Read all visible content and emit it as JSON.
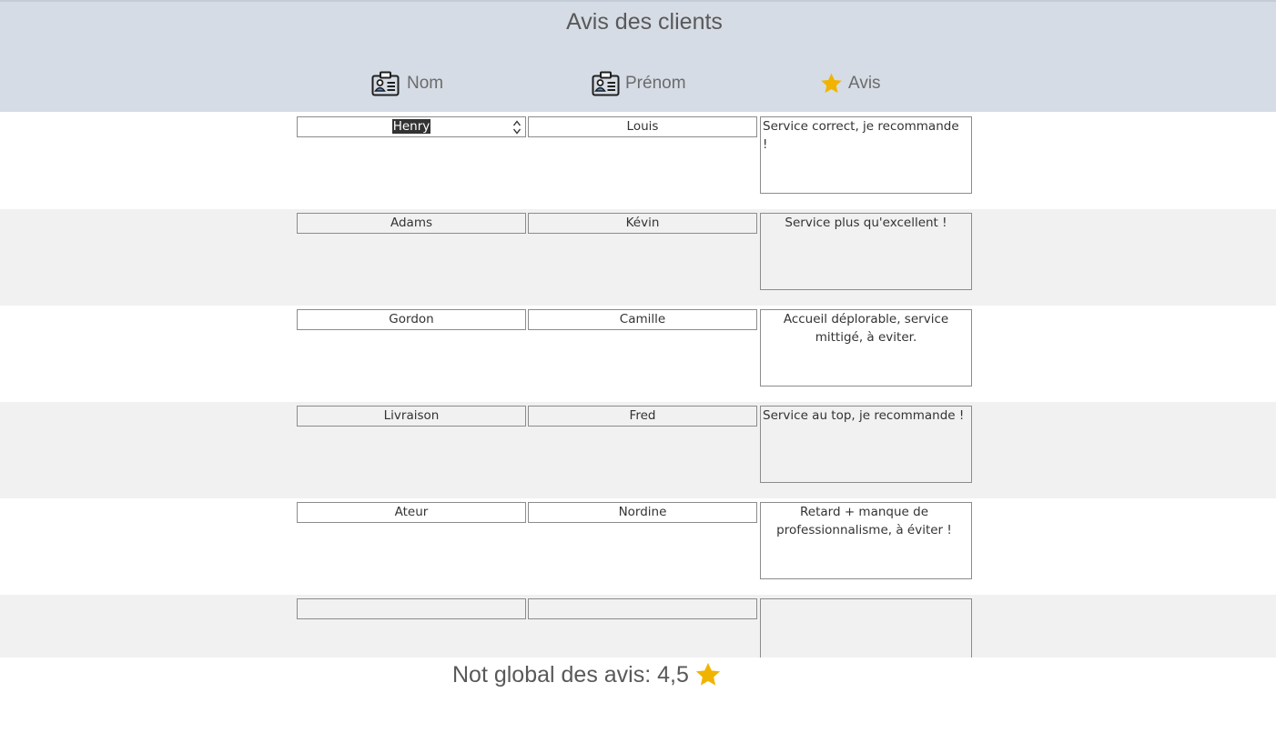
{
  "page": {
    "title": "Avis des clients"
  },
  "columns": [
    {
      "label": "Nom",
      "icon": "id-badge-icon"
    },
    {
      "label": "Prénom",
      "icon": "id-badge-icon"
    },
    {
      "label": "Avis",
      "icon": "star-icon"
    }
  ],
  "colors": {
    "header_bg": "#d6dce5",
    "alt_row_bg": "#f1f1f1",
    "star": "#f0b400",
    "text": "#595959"
  },
  "rows": [
    {
      "nom": "Henry",
      "prenom": "Louis",
      "avis": "Service correct, je recommande !"
    },
    {
      "nom": "Adams",
      "prenom": "Kévin",
      "avis": "Service plus qu'excellent !"
    },
    {
      "nom": "Gordon",
      "prenom": "Camille",
      "avis": "Accueil déplorable, service mittigé, à eviter."
    },
    {
      "nom": "Livraison",
      "prenom": "Fred",
      "avis": "Service au top, je recommande !"
    },
    {
      "nom": "Ateur",
      "prenom": "Nordine",
      "avis": "Retard + manque de professionnalisme, à éviter !"
    },
    {
      "nom": "",
      "prenom": "",
      "avis": ""
    }
  ],
  "footer": {
    "label": "Not global des avis: 4,5",
    "rating_value": 4.5
  }
}
